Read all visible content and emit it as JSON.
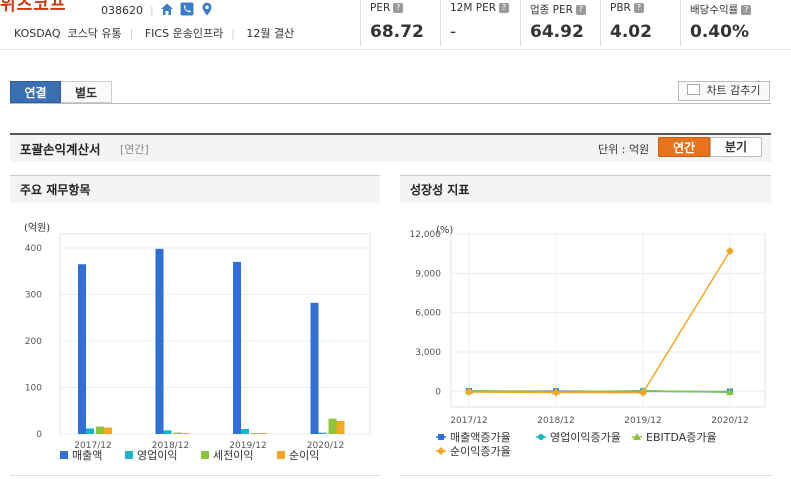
{
  "header": {
    "company_name": "위즈코프",
    "stock_code": "038620",
    "icons": [
      "home-icon",
      "phone-icon",
      "location-icon"
    ],
    "market": "KOSDAQ",
    "market_sector": "코스닥 유통",
    "fics": "FICS 운송인프라",
    "settlement": "12월 결산"
  },
  "metrics": [
    {
      "label": "PER",
      "value": "68.72"
    },
    {
      "label": "12M PER",
      "value": "-"
    },
    {
      "label": "업종 PER",
      "value": "64.92"
    },
    {
      "label": "PBR",
      "value": "4.02"
    },
    {
      "label": "배당수익률",
      "value": "0.40%"
    }
  ],
  "tabs": {
    "consolidated": "연결",
    "separate": "별도"
  },
  "chart_toggle": "차트 감추기",
  "section": {
    "title": "포괄손익계산서",
    "subtitle": "[연간]",
    "unit": "단위 : 억원",
    "annual": "연간",
    "quarter": "분기"
  },
  "colors": {
    "sales": "#2f6fd6",
    "operating": "#18b6c7",
    "pretax": "#8cc43c",
    "net": "#f5a623",
    "accent": "#e8731c",
    "tab_active": "#3a6fb3"
  },
  "left_panel": {
    "title": "주요 재무항목"
  },
  "right_panel": {
    "title": "성장성 지표"
  },
  "chart_data": [
    {
      "type": "bar",
      "ylabel": "(억원)",
      "categories": [
        "2017/12",
        "2018/12",
        "2019/12",
        "2020/12"
      ],
      "yticks": [
        "0",
        "100",
        "200",
        "300",
        "400"
      ],
      "ylim": [
        0,
        430
      ],
      "grid": true,
      "legend_position": "bottom",
      "series": [
        {
          "name": "매출액",
          "values": [
            365,
            398,
            370,
            282
          ]
        },
        {
          "name": "영업이익",
          "values": [
            12,
            8,
            11,
            3
          ]
        },
        {
          "name": "세전이익",
          "values": [
            16,
            3,
            1,
            33
          ]
        },
        {
          "name": "순이익",
          "values": [
            14,
            1,
            0,
            28
          ]
        }
      ]
    },
    {
      "type": "line",
      "ylabel": "(%)",
      "categories": [
        "2017/12",
        "2018/12",
        "2019/12",
        "2020/12"
      ],
      "yticks": [
        "0",
        "3,000",
        "6,000",
        "9,000",
        "12,000"
      ],
      "ylim": [
        -1200,
        12000
      ],
      "grid": true,
      "legend_position": "bottom",
      "series": [
        {
          "name": "매출액증가율",
          "values": [
            12,
            9,
            -7,
            -24
          ]
        },
        {
          "name": "영업이익증가율",
          "values": [
            30,
            -33,
            37,
            -73
          ]
        },
        {
          "name": "EBITDA증가율",
          "values": [
            25,
            -30,
            20,
            -60
          ]
        },
        {
          "name": "순이익증가율",
          "values": [
            -60,
            -93,
            -100,
            10700
          ]
        }
      ]
    }
  ]
}
